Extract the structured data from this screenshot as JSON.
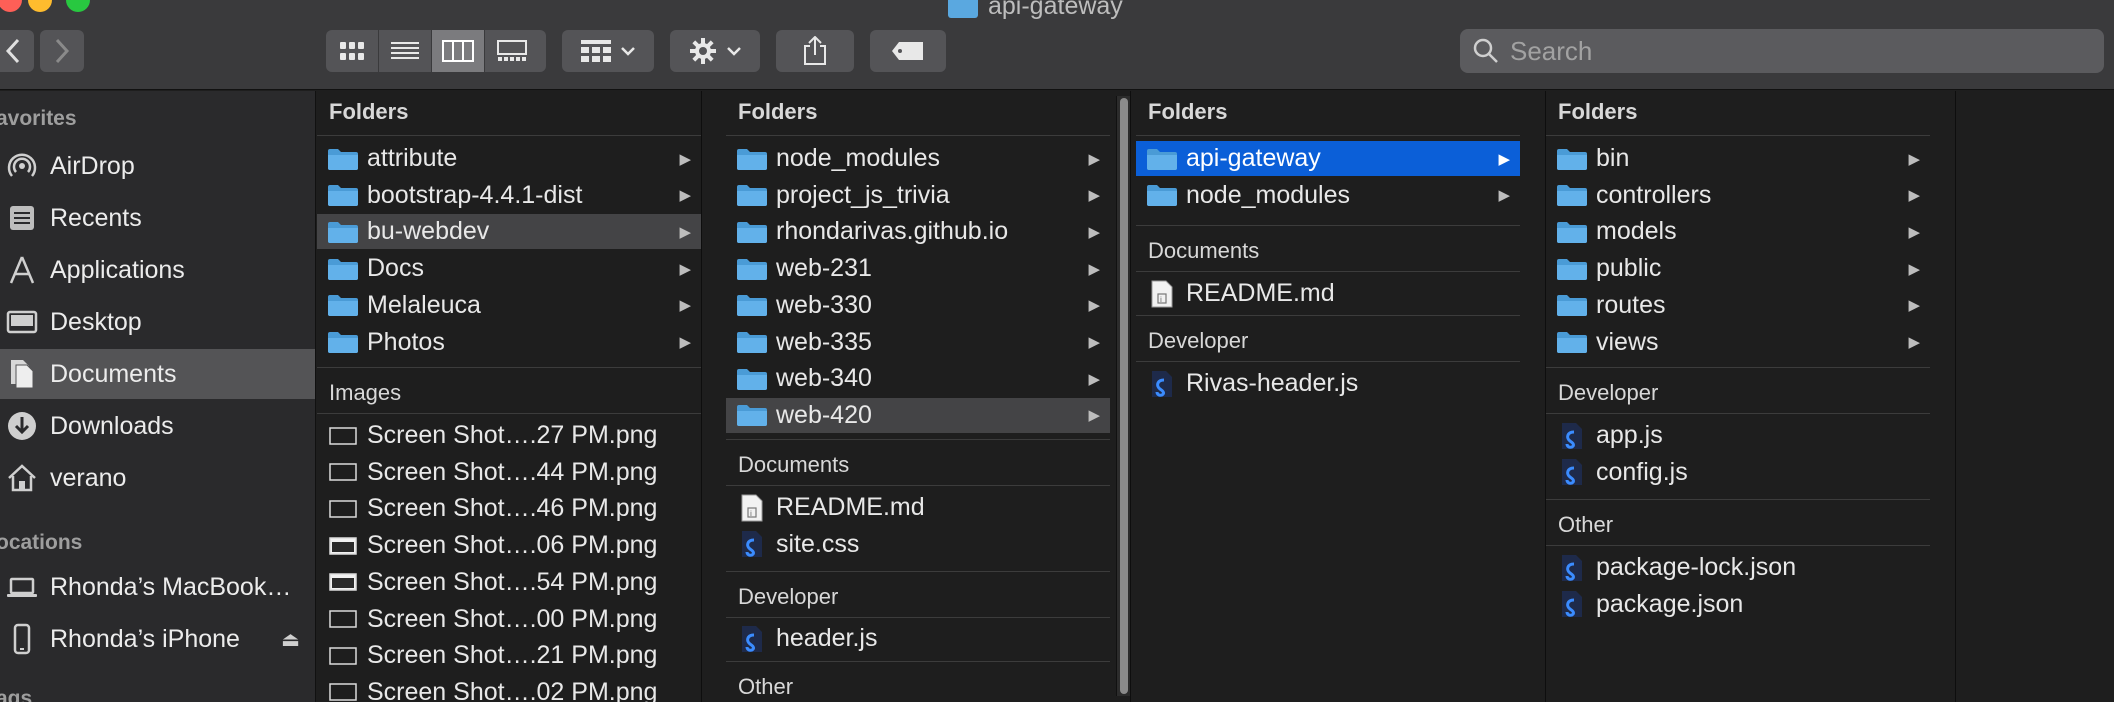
{
  "window": {
    "title": "api-gateway"
  },
  "toolbar": {
    "search_placeholder": "Search",
    "view_modes": [
      "icon-view",
      "list-view",
      "column-view",
      "gallery-view"
    ],
    "active_view": "column-view"
  },
  "sidebar": {
    "favorites_header": "avorites",
    "favorites": [
      {
        "label": "AirDrop",
        "icon": "airdrop-icon"
      },
      {
        "label": "Recents",
        "icon": "recents-icon"
      },
      {
        "label": "Applications",
        "icon": "applications-icon"
      },
      {
        "label": "Desktop",
        "icon": "desktop-icon"
      },
      {
        "label": "Documents",
        "icon": "documents-icon",
        "selected": true
      },
      {
        "label": "Downloads",
        "icon": "downloads-icon"
      },
      {
        "label": "verano",
        "icon": "home-icon"
      }
    ],
    "locations_header": "ocations",
    "locations": [
      {
        "label": "Rhonda’s MacBook…",
        "icon": "laptop-icon"
      },
      {
        "label": "Rhonda’s iPhone",
        "icon": "iphone-icon",
        "eject": "⏏"
      }
    ],
    "tags_header": "ags"
  },
  "columns": [
    {
      "folders_header": "Folders",
      "folders": [
        "attribute",
        "bootstrap-4.4.1-dist",
        "bu-webdev",
        "Docs",
        "Melaleuca",
        "Photos"
      ],
      "selected_folder": "bu-webdev",
      "images_header": "Images",
      "images": [
        "Screen Shot….27 PM.png",
        "Screen Shot….44 PM.png",
        "Screen Shot….46 PM.png",
        "Screen Shot….06 PM.png",
        "Screen Shot….54 PM.png",
        "Screen Shot….00 PM.png",
        "Screen Shot….21 PM.png",
        "Screen Shot….02 PM.png"
      ]
    },
    {
      "folders_header": "Folders",
      "folders": [
        "node_modules",
        "project_js_trivia",
        "rhondarivas.github.io",
        "web-231",
        "web-330",
        "web-335",
        "web-340",
        "web-420"
      ],
      "selected_folder": "web-420",
      "documents_header": "Documents",
      "documents": [
        "README.md",
        "site.css"
      ],
      "developer_header": "Developer",
      "developer": [
        "header.js"
      ],
      "other_header": "Other"
    },
    {
      "folders_header": "Folders",
      "folders": [
        "api-gateway",
        "node_modules"
      ],
      "selected_folder": "api-gateway",
      "documents_header": "Documents",
      "documents": [
        "README.md"
      ],
      "developer_header": "Developer",
      "developer": [
        "Rivas-header.js"
      ]
    },
    {
      "folders_header": "Folders",
      "folders": [
        "bin",
        "controllers",
        "models",
        "public",
        "routes",
        "views"
      ],
      "developer_header": "Developer",
      "developer": [
        "app.js",
        "config.js"
      ],
      "other_header": "Other",
      "other": [
        "package-lock.json",
        "package.json"
      ]
    }
  ],
  "colors": {
    "selection_blue": "#0b5fd8",
    "folder_blue": "#5aa8e0",
    "traffic_red": "#fe5f57",
    "traffic_yellow": "#febc2e",
    "traffic_green": "#28c840"
  }
}
